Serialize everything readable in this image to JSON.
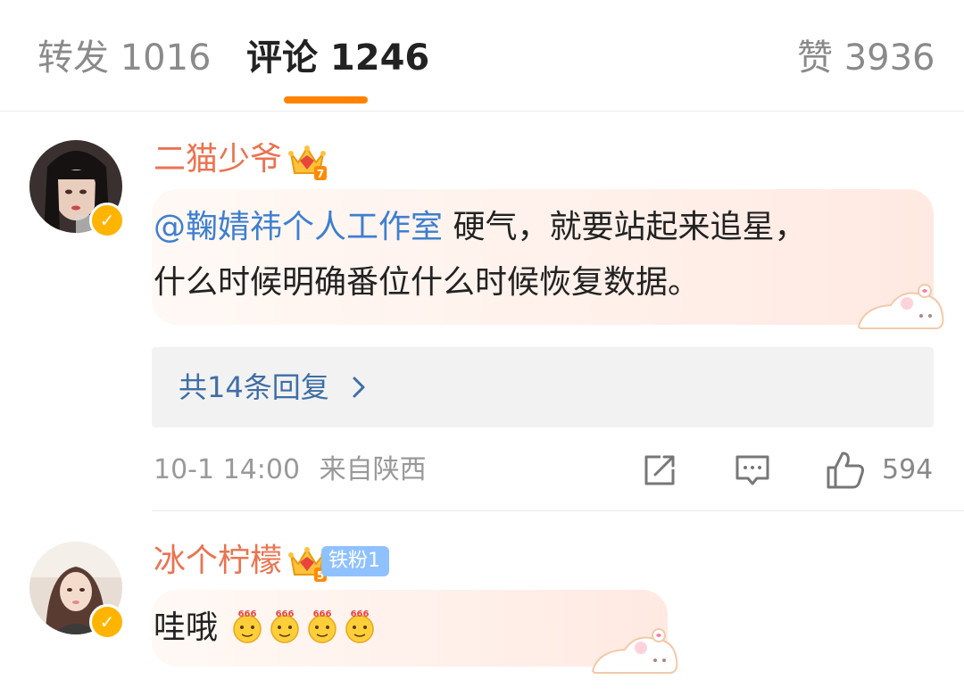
{
  "tabs": [
    {
      "label": "转发 1016"
    },
    {
      "label": "评论 1246"
    },
    {
      "label": "赞 3936"
    }
  ],
  "comments": [
    {
      "username": "二猫少爷",
      "crown_level": "7",
      "mention": "@鞠婧祎个人工作室",
      "text_line1": " 硬气，就要站起来追星，",
      "text_line2": "什么时候明确番位什么时候恢复数据。",
      "reply_summary": "共14条回复",
      "timestamp": "10-1 14:00",
      "location": "来自陕西",
      "like_count": "594"
    },
    {
      "username": "冰个柠檬",
      "crown_level": "5",
      "badge": "铁粉1",
      "text": "哇哦",
      "emoji_label": "666"
    }
  ],
  "icons": {
    "share": "share-icon",
    "comment": "comment-icon",
    "like": "thumbs-up-icon",
    "verified": "verified-badge-icon",
    "crown": "crown-icon",
    "chevron": "chevron-right-icon"
  },
  "colors": {
    "accent": "#ff8200",
    "username": "#eb7350",
    "link": "#3e7fcf",
    "muted": "#999999"
  }
}
